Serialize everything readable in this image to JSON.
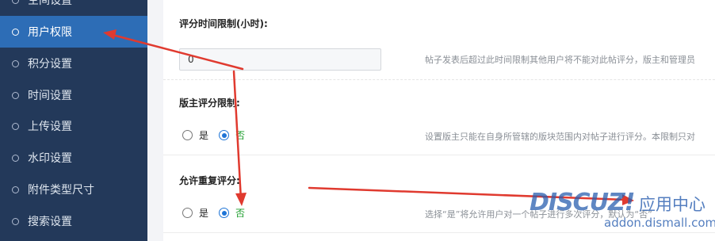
{
  "sidebar": {
    "items": [
      {
        "label": "空间设置",
        "active": false
      },
      {
        "label": "用户权限",
        "active": true
      },
      {
        "label": "积分设置",
        "active": false
      },
      {
        "label": "时间设置",
        "active": false
      },
      {
        "label": "上传设置",
        "active": false
      },
      {
        "label": "水印设置",
        "active": false
      },
      {
        "label": "附件类型尺寸",
        "active": false
      },
      {
        "label": "搜索设置",
        "active": false
      }
    ]
  },
  "settings": {
    "rating_time_limit": {
      "label": "评分时间限制(小时):",
      "value": "0",
      "description": "帖子发表后超过此时间限制其他用户将不能对此帖评分，版主和管理员"
    },
    "moderator_rating_limit": {
      "label": "版主评分限制:",
      "yes_label": "是",
      "no_label": "否",
      "selected": "否",
      "description": "设置版主只能在自身所管辖的版块范围内对帖子进行评分。本限制只对"
    },
    "allow_repeat_rating": {
      "label": "允许重复评分:",
      "yes_label": "是",
      "no_label": "否",
      "selected": "否",
      "description": "选择“是”将允许用户对一个帖子进行多次评分，默认为“否”"
    }
  },
  "watermark": {
    "logo": "DISCUZ!",
    "tagline": "应用中心",
    "url": "addon.dismall.com"
  },
  "colors": {
    "sidebar_bg": "#23395a",
    "sidebar_active": "#2d6db6",
    "annotation_arrow": "#e03a2f",
    "radio_checked": "#1e74d6",
    "selected_text": "#1a9c2a"
  }
}
